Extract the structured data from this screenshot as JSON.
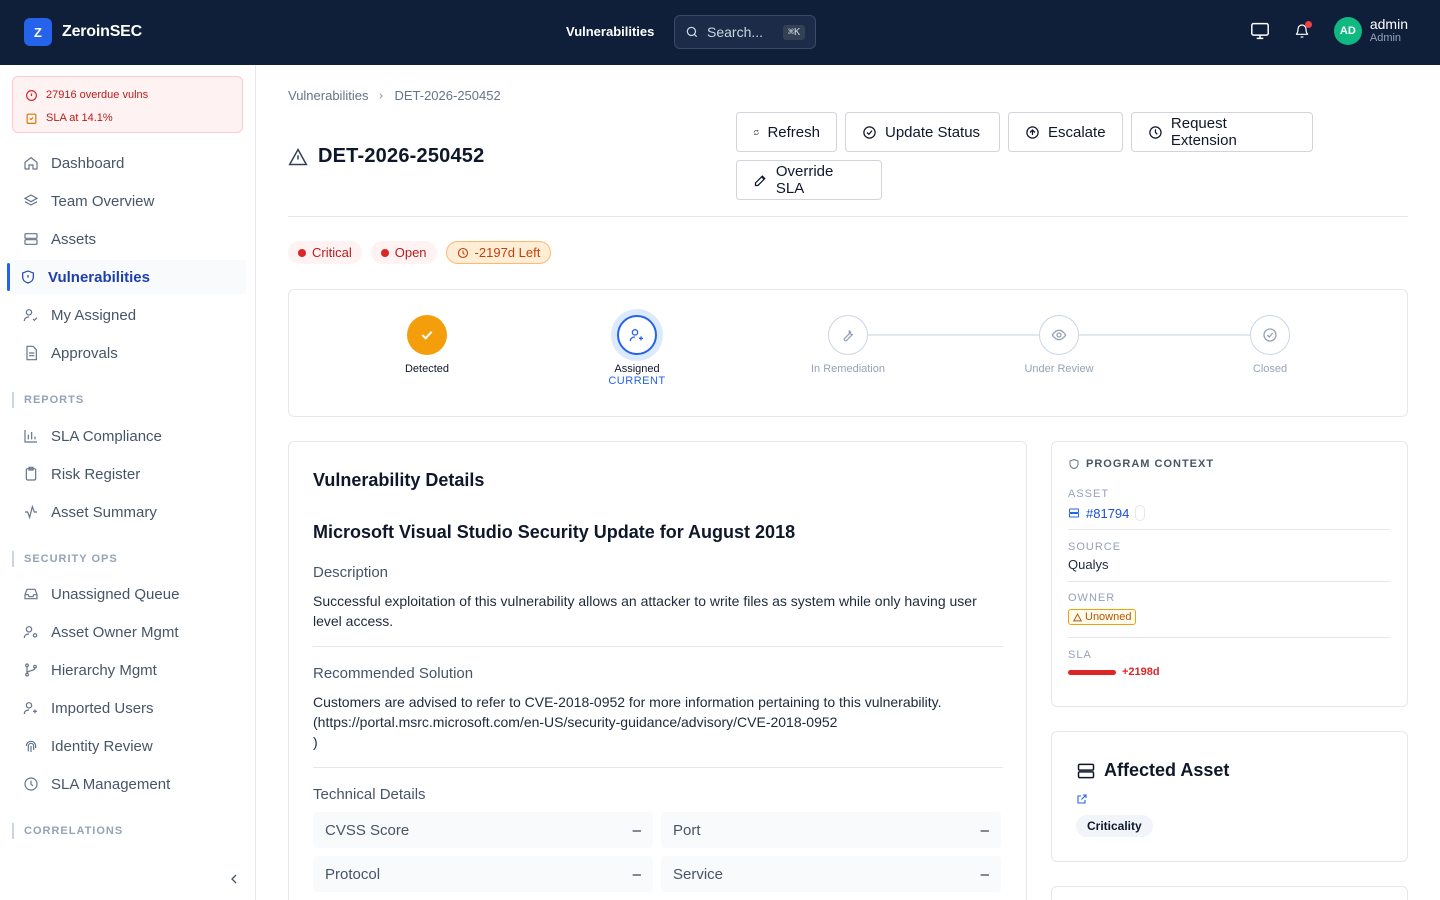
{
  "header": {
    "brand_initial": "Z",
    "brand_name": "ZeroinSEC",
    "nav_active": "Vulnerabilities",
    "search_placeholder": "Search...",
    "search_shortcut": "⌘K",
    "user_initials": "AD",
    "user_name": "admin",
    "user_role": "Admin"
  },
  "alerts": {
    "overdue": "27916 overdue vulns",
    "sla": "SLA at 14.1%"
  },
  "sidebar": {
    "main": [
      "Dashboard",
      "Team Overview",
      "Assets",
      "Vulnerabilities",
      "My Assigned",
      "Approvals"
    ],
    "reports_title": "REPORTS",
    "reports": [
      "SLA Compliance",
      "Risk Register",
      "Asset Summary"
    ],
    "secops_title": "SECURITY OPS",
    "secops": [
      "Unassigned Queue",
      "Asset Owner Mgmt",
      "Hierarchy Mgmt",
      "Imported Users",
      "Identity Review",
      "SLA Management"
    ],
    "correlations_title": "CORRELATIONS"
  },
  "breadcrumb": {
    "parent": "Vulnerabilities",
    "current": "DET-2026-250452"
  },
  "page_title": "DET-2026-250452",
  "actions": {
    "refresh": "Refresh",
    "update_status": "Update Status",
    "escalate": "Escalate",
    "request_extension": "Request Extension",
    "override_sla": "Override SLA"
  },
  "badges": {
    "severity": "Critical",
    "status": "Open",
    "sla_left": "-2197d Left"
  },
  "workflow": {
    "steps": [
      "Detected",
      "Assigned",
      "In Remediation",
      "Under Review",
      "Closed"
    ],
    "current_label": "CURRENT"
  },
  "details": {
    "heading": "Vulnerability Details",
    "title": "Microsoft Visual Studio Security Update for August 2018",
    "description_label": "Description",
    "description": "Successful exploitation of this vulnerability allows an attacker to write files as system while only having user level access.",
    "solution_label": "Recommended Solution",
    "solution_line1": "Customers are advised to refer to CVE-2018-0952 for more information pertaining to this vulnerability.",
    "solution_line2": "(https://portal.msrc.microsoft.com/en-US/security-guidance/advisory/CVE-2018-0952",
    "solution_line3": ")",
    "technical_label": "Technical Details",
    "cvss_label": "CVSS Score",
    "cvss_value": "–",
    "port_label": "Port",
    "port_value": "–",
    "protocol_label": "Protocol",
    "protocol_value": "–",
    "service_label": "Service",
    "service_value": "–"
  },
  "context": {
    "heading": "PROGRAM CONTEXT",
    "asset_label": "ASSET",
    "asset_value": "#81794",
    "source_label": "SOURCE",
    "source_value": "Qualys",
    "owner_label": "OWNER",
    "owner_value": "Unowned",
    "sla_label": "SLA",
    "sla_value": "+2198d"
  },
  "affected": {
    "heading": "Affected Asset",
    "criticality": "Criticality"
  }
}
